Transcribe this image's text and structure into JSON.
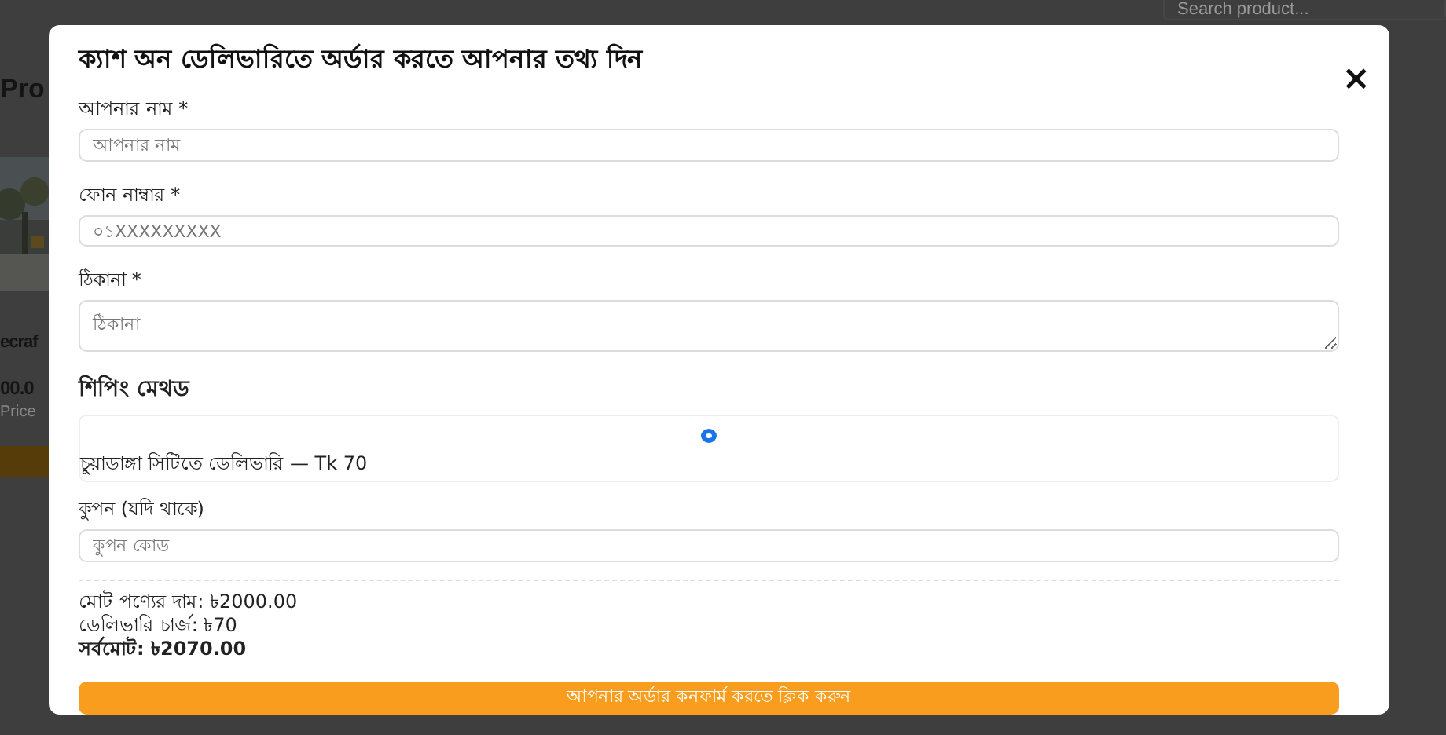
{
  "background_page": {
    "search": {
      "placeholder": "Search product..."
    },
    "heading": "Pro",
    "product": {
      "kind": "picture",
      "name": "ecraf",
      "price": "00.0",
      "price_label": "Price"
    }
  },
  "modal": {
    "title": "ক্যাশ অন ডেলিভারিতে অর্ডার করতে আপনার তথ্য দিন",
    "close": "×",
    "fields": [
      {
        "kind": "input",
        "label": "আপনার নাম *",
        "placeholder": "আপনার নাম"
      },
      {
        "kind": "input",
        "label": "ফোন নাম্বার *",
        "placeholder": "০১XXXXXXXXX"
      },
      {
        "kind": "textarea",
        "label": "ঠিকানা *",
        "placeholder": "ঠিকানা"
      }
    ],
    "shipping": {
      "title": "শিপিং মেথড",
      "options": [
        {
          "label": "চুয়াডাঙ্গা সিটিতে ডেলিভারি — Tk 70",
          "selected": true
        }
      ]
    },
    "coupon": {
      "label": "কুপন (যদি থাকে)",
      "placeholder": "কুপন কোড"
    },
    "summary": [
      {
        "kind": "line",
        "text": "মোট পণ্যের দাম: ৳2000.00"
      },
      {
        "kind": "line",
        "text": "ডেলিভারি চার্জ: ৳70"
      },
      {
        "kind": "total",
        "text": "সর্বমোট: ৳2070.00"
      }
    ],
    "submit": "আপনার অর্ডার কনফার্ম করতে ক্লিক করুন"
  }
}
